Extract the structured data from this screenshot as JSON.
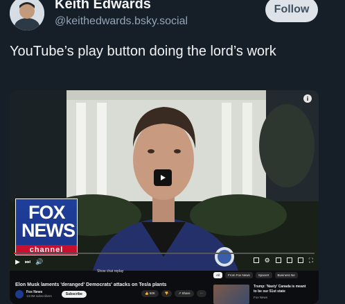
{
  "author": {
    "display_name": "Keith Edwards",
    "handle": "@keithedwards.bsky.social",
    "follow_label": "Follow"
  },
  "post": {
    "text": "YouTube’s play button doing the lord’s work"
  },
  "video": {
    "overlay_logo": {
      "line1": "FOX",
      "line2": "NEWS",
      "line3": "channel"
    },
    "progress_fraction": 0.01,
    "chat_replay_label": "Show chat replay",
    "title": "Elon Musk laments 'deranged' Democrats' attacks on Tesla plants",
    "channel_name": "Fox News",
    "subscribers": "13.9M subscribers",
    "subscribe_label": "Subscribe",
    "likes": "50K",
    "share_label": "Share",
    "chips": [
      "All",
      "From Fox News",
      "SpaceX",
      "Business Ne"
    ],
    "recommended": {
      "title": "Trump: 'Nasty' Canada is meant to be our 51st state",
      "channel": "Fox News"
    }
  },
  "icons": {
    "info": "info-icon",
    "play": "play-icon",
    "more": "more-vertical-icon"
  }
}
